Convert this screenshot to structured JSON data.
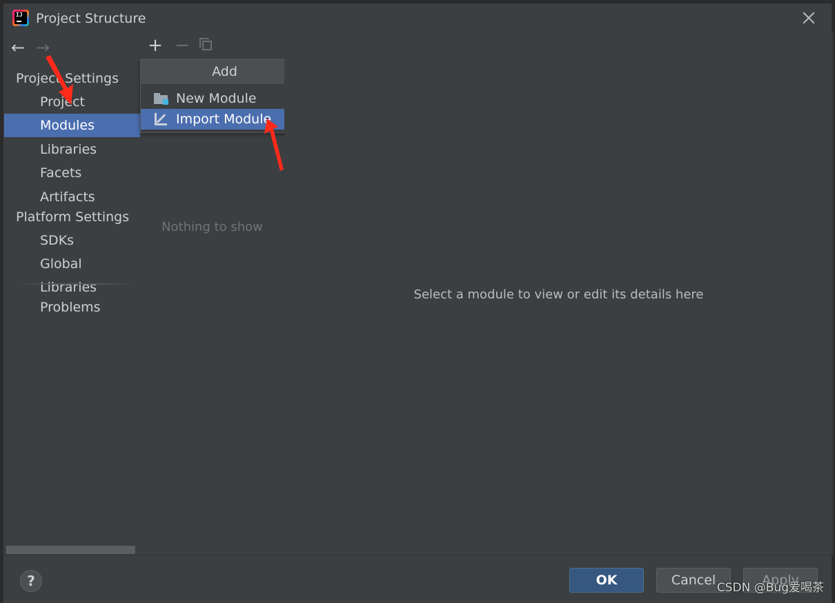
{
  "window": {
    "title": "Project Structure",
    "app_icon": "intellij-idea-icon",
    "app_icon_text": "IJ"
  },
  "sidebar": {
    "section_project": "Project Settings",
    "section_platform": "Platform Settings",
    "items": [
      {
        "label": "Project"
      },
      {
        "label": "Modules",
        "selected": true
      },
      {
        "label": "Libraries"
      },
      {
        "label": "Facets"
      },
      {
        "label": "Artifacts"
      },
      {
        "label": "SDKs"
      },
      {
        "label": "Global Libraries"
      },
      {
        "label": "Problems"
      }
    ]
  },
  "middle": {
    "empty_text": "Nothing to show"
  },
  "add_popup": {
    "header": "Add",
    "items": [
      {
        "label": "New Module",
        "icon": "folder-module-icon"
      },
      {
        "label": "Import Module",
        "icon": "import-arrow-icon",
        "selected": true
      }
    ]
  },
  "content": {
    "message": "Select a module to view or edit its details here"
  },
  "footer": {
    "help": "?",
    "ok": "OK",
    "cancel": "Cancel",
    "apply": "Apply"
  },
  "watermark": "CSDN @Bug爱喝茶",
  "colors": {
    "background": "#3c3f41",
    "selection": "#4b6eaf",
    "annotation": "#ff2a1a"
  }
}
